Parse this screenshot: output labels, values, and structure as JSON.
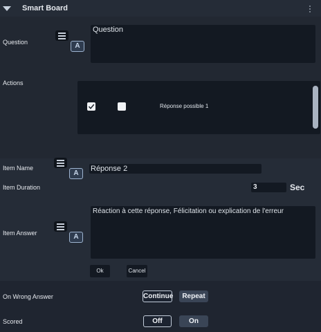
{
  "header": {
    "title": "Smart Board"
  },
  "question": {
    "label": "Question",
    "value": "Question"
  },
  "actions": {
    "label": "Actions",
    "rows": [
      {
        "checked": true,
        "correct": false,
        "text": "Réponse possible 1"
      }
    ]
  },
  "item": {
    "name_label": "Item Name",
    "name_value": "Réponse 2",
    "duration_label": "Item Duration",
    "duration_value": "3",
    "duration_unit": "Sec",
    "answer_label": "Item Answer",
    "answer_value": "Réaction à cette réponse, Félicitation ou explication de l'erreur",
    "ok_label": "Ok",
    "cancel_label": "Cancel"
  },
  "wrong_answer": {
    "label": "On Wrong Answer",
    "options": [
      "Continue",
      "Repeat"
    ],
    "selected": "Continue"
  },
  "scored": {
    "label": "Scored",
    "options": [
      "Off",
      "On"
    ],
    "selected": "Off"
  },
  "icons": {
    "collapse": "triangle-down-icon",
    "menu": "kebab-menu-icon",
    "editor": "text-lines-icon",
    "font": "letter-a-icon",
    "check": "checkmark-icon"
  },
  "colors": {
    "panel": "#252c37",
    "field": "#131922",
    "button_unselected": "#3a4556",
    "accent_border": "#9fb5d1"
  }
}
